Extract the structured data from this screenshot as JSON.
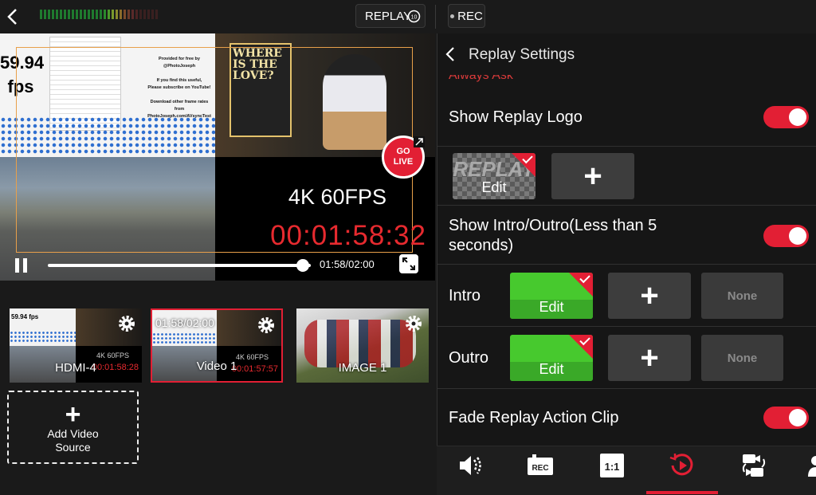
{
  "topbar": {
    "replay_label": "REPLAY",
    "replay_badge": "10",
    "rec_label": "REC",
    "meter_colors": [
      "#1f7a2e",
      "#1f7a2e",
      "#1f7a2e",
      "#1f7a2e",
      "#1f7a2e",
      "#1f7a2e",
      "#1f7a2e",
      "#1f7a2e",
      "#1f7a2e",
      "#1f7a2e",
      "#1f7a2e",
      "#1f7a2e",
      "#1f7a2e",
      "#1f7a2e",
      "#1f7a2e",
      "#1f7a2e",
      "#2a8a2c",
      "#4a9a2c",
      "#7a9a2c",
      "#8a8a2c",
      "#8a6a2a",
      "#7a4a2a",
      "#6a3a2a",
      "#5a2a2a",
      "#4a2222",
      "#3a2020",
      "#3a2020",
      "#3a2020",
      "#3a2020",
      "#3a2020"
    ]
  },
  "preview": {
    "fps_value": "59.94",
    "fps_unit": "fps",
    "free_text": [
      "Provided for free by",
      "@PhotoJoseph",
      "If you find this useful,",
      "Please subscribe on YouTube!",
      "Download other frame rates from",
      "PhotoJoseph.com/AVsyncTest"
    ],
    "poster_title": "WHERE IS THE LOVE?",
    "overlay_4k": "4K 60FPS",
    "overlay_timecode": "00:01:58:32",
    "go_live": "GO LIVE",
    "playback_time": "01:58/02:00",
    "progress": 0.97
  },
  "sources": [
    {
      "label": "HDMI-4",
      "fps": "59.94 fps",
      "overlay": "4K 60FPS",
      "timecode": "00:01:58:28",
      "selected": false
    },
    {
      "label": "Video 1",
      "time": "01:58/02:00",
      "overlay": "4K 60FPS",
      "timecode": "00:01:57:57",
      "selected": true
    },
    {
      "label": "IMAGE 1",
      "selected": false
    }
  ],
  "add_source": {
    "line1": "Add Video",
    "line2": "Source"
  },
  "settings": {
    "title": "Replay Settings",
    "always_ask": "Always Ask",
    "show_logo_label": "Show Replay Logo",
    "show_logo_on": true,
    "logo_watermark": "REPLAY",
    "edit_label": "Edit",
    "intro_outro_label": "Show Intro/Outro(Less than 5 seconds)",
    "intro_outro_on": true,
    "intro_label": "Intro",
    "outro_label": "Outro",
    "none_label": "None",
    "fade_label": "Fade Replay Action Clip",
    "fade_on": true
  },
  "tabs": [
    "audio-icon",
    "rec-icon",
    "aspect-ratio-icon",
    "replay-icon",
    "switch-camera-icon",
    "person-icon"
  ],
  "tab_texts": {
    "rec": "REC",
    "ratio": "1:1"
  },
  "colors": {
    "accent": "#e21f34",
    "timecode": "#e72a2f",
    "green_tile": "#47c92e"
  }
}
